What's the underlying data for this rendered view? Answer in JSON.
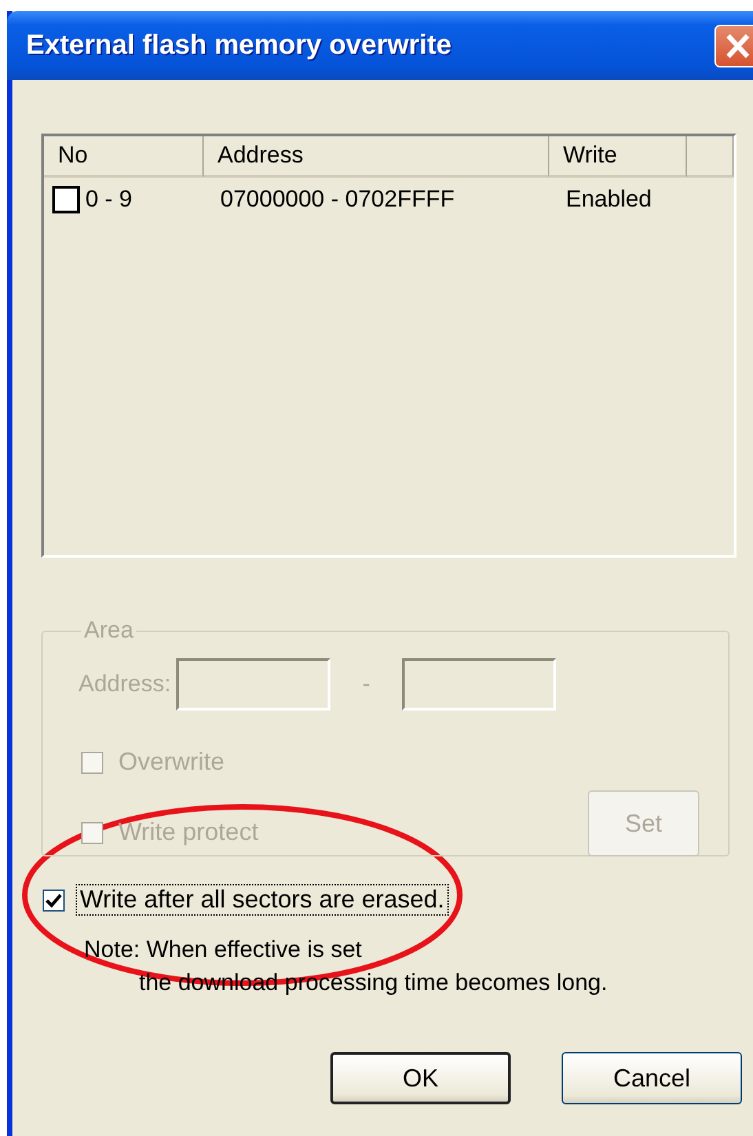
{
  "window": {
    "title": "External flash memory overwrite"
  },
  "list": {
    "columns": [
      "No",
      "Address",
      "Write"
    ],
    "rows": [
      {
        "checked": false,
        "cells": [
          "0 - 9",
          "07000000 - 0702FFFF",
          "Enabled"
        ]
      }
    ]
  },
  "area": {
    "label": "Area",
    "disabled": true,
    "address_label": "Address:",
    "separator": "-",
    "options": [
      {
        "label": "Overwrite",
        "checked": false
      },
      {
        "label": "Write protect",
        "checked": false
      }
    ],
    "set_button": "Set"
  },
  "erase_option": {
    "label": "Write after all sectors are erased.",
    "checked": true,
    "focused": true
  },
  "note": [
    "Note: When effective is set",
    "the download processing time becomes long."
  ],
  "buttons": [
    {
      "label": "OK",
      "default": true
    },
    {
      "label": "Cancel",
      "default": false
    }
  ]
}
